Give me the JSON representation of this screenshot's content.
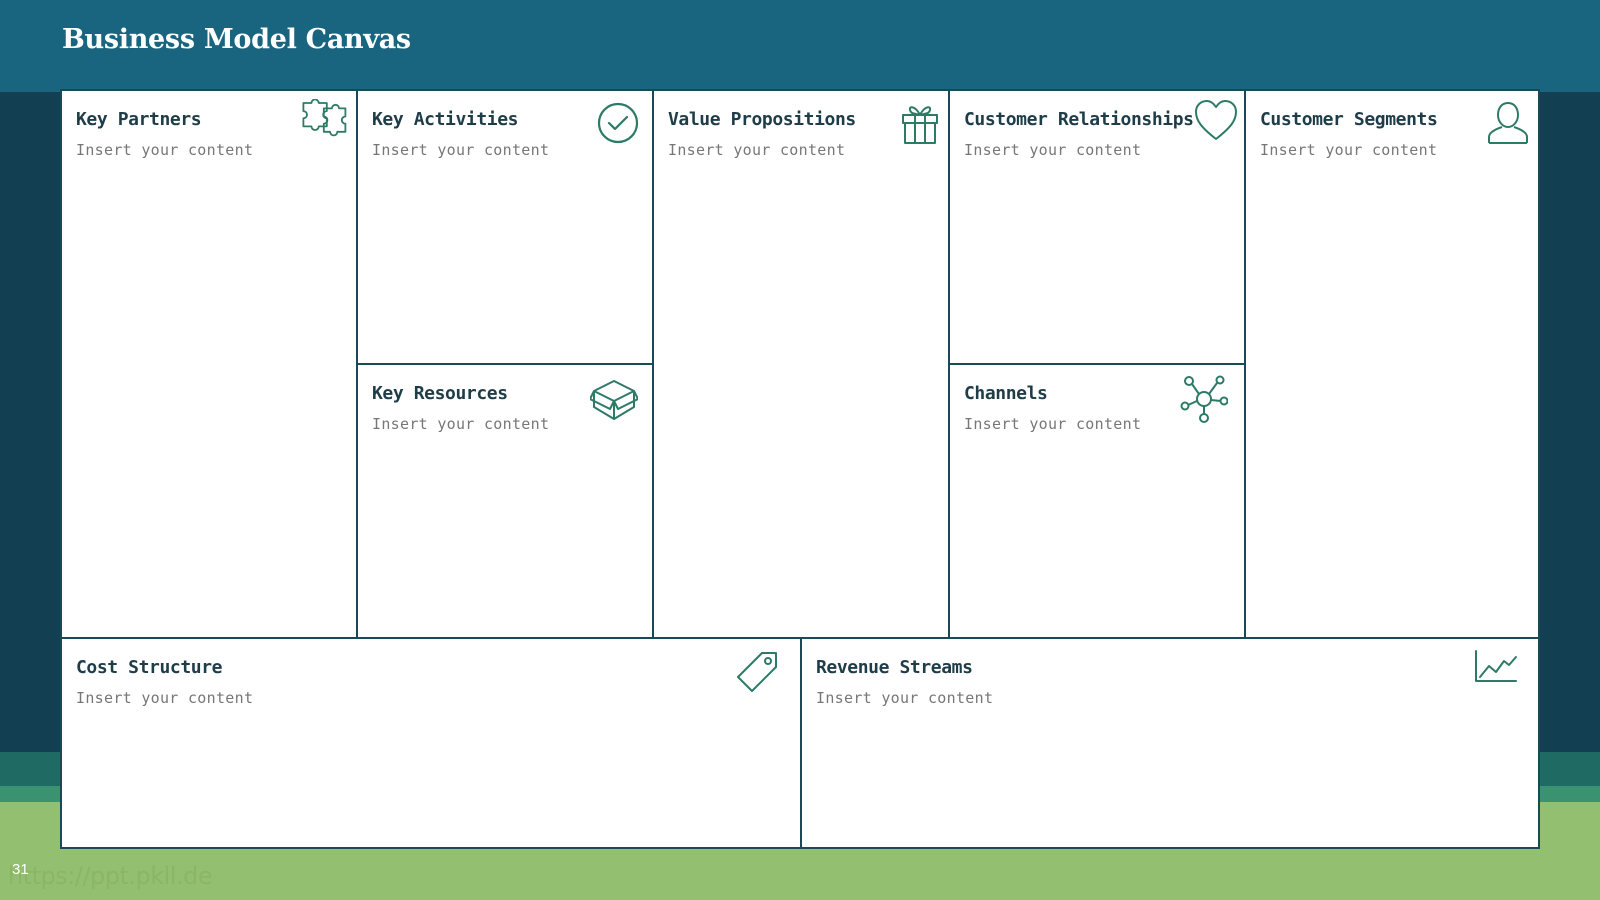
{
  "slide": {
    "title": "Business Model Canvas",
    "number": "31",
    "watermark": "https://ppt.pkll.de"
  },
  "colors": {
    "header": "#19647e",
    "background": "#123f52",
    "footer_green": "#93c070",
    "border": "#1a4a57",
    "icon": "#2d7a67"
  },
  "blocks": {
    "key_partners": {
      "label": "Key Partners",
      "body": "Insert your content",
      "icon": "puzzle-icon"
    },
    "key_activities": {
      "label": "Key Activities",
      "body": "Insert your content",
      "icon": "check-circle-icon"
    },
    "key_resources": {
      "label": "Key Resources",
      "body": "Insert your content",
      "icon": "box-icon"
    },
    "value_propositions": {
      "label": "Value Propositions",
      "body": "Insert your content",
      "icon": "gift-icon"
    },
    "customer_relationships": {
      "label": "Customer Relationships",
      "body": "Insert your content",
      "icon": "heart-icon"
    },
    "channels": {
      "label": "Channels",
      "body": "Insert your content",
      "icon": "network-icon"
    },
    "customer_segments": {
      "label": "Customer Segments",
      "body": "Insert your content",
      "icon": "user-icon"
    },
    "cost_structure": {
      "label": "Cost Structure",
      "body": "Insert your content",
      "icon": "price-tag-icon"
    },
    "revenue_streams": {
      "label": "Revenue Streams",
      "body": "Insert your content",
      "icon": "line-chart-icon"
    }
  }
}
